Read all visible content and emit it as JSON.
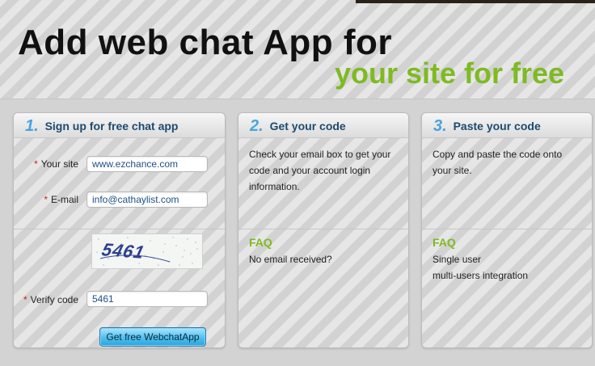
{
  "header": {
    "title_line1": "Add web chat App for",
    "title_line2": "your site for free"
  },
  "steps": [
    {
      "number": "1.",
      "title": "Sign up for free chat app"
    },
    {
      "number": "2.",
      "title": "Get your code"
    },
    {
      "number": "3.",
      "title": "Paste your code"
    }
  ],
  "signup_form": {
    "site_label": "Your site",
    "site_value": "www.ezchance.com",
    "email_label": "E-mail",
    "email_value": "info@cathaylist.com",
    "captcha_text": "5461",
    "verify_label": "Verify code",
    "verify_value": "5461",
    "required_marker": "*",
    "submit_label": "Get free WebchatApp"
  },
  "get_code": {
    "description": "Check your email box to get your code and your account login information.",
    "faq_title": "FAQ",
    "faq_items": [
      "No email received?"
    ]
  },
  "paste_code": {
    "description": "Copy and paste the code onto your site.",
    "faq_title": "FAQ",
    "faq_items": [
      "Single user",
      "multi-users integration"
    ]
  },
  "colors": {
    "accent_green": "#7fba22",
    "step_blue": "#4aa3df",
    "heading_navy": "#1e4a6e",
    "button_blue": "#4ec0f0",
    "required_red": "#d21d1d"
  }
}
